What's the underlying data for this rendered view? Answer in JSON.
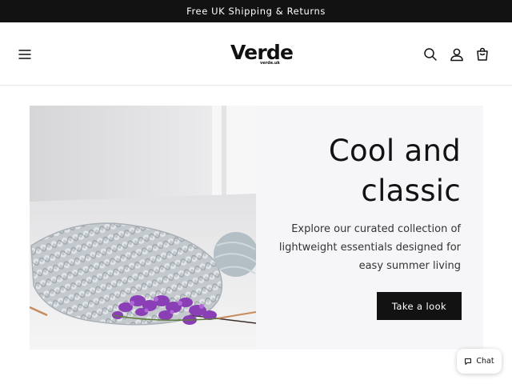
{
  "announcement": {
    "text": "Free UK Shipping & Returns"
  },
  "header": {
    "logo_text": "Verde",
    "logo_subtext": "verde.uk",
    "icons": [
      "menu-icon",
      "search-icon",
      "account-icon",
      "cart-icon"
    ]
  },
  "hero": {
    "heading_line1": "Cool and",
    "heading_line2": "classic",
    "subtext": "Explore our curated collection of lightweight essentials designed for easy summer living",
    "button_label": "Take a look",
    "image_alt": "Knitting with grey cable-knit yarn, yarn ball and purple lilac flowers"
  },
  "chat": {
    "label": "Chat"
  },
  "colors": {
    "announcement_bg": "#121212",
    "banner_bg": "#f6f6f9",
    "button_bg": "#121212",
    "text": "#121212"
  }
}
